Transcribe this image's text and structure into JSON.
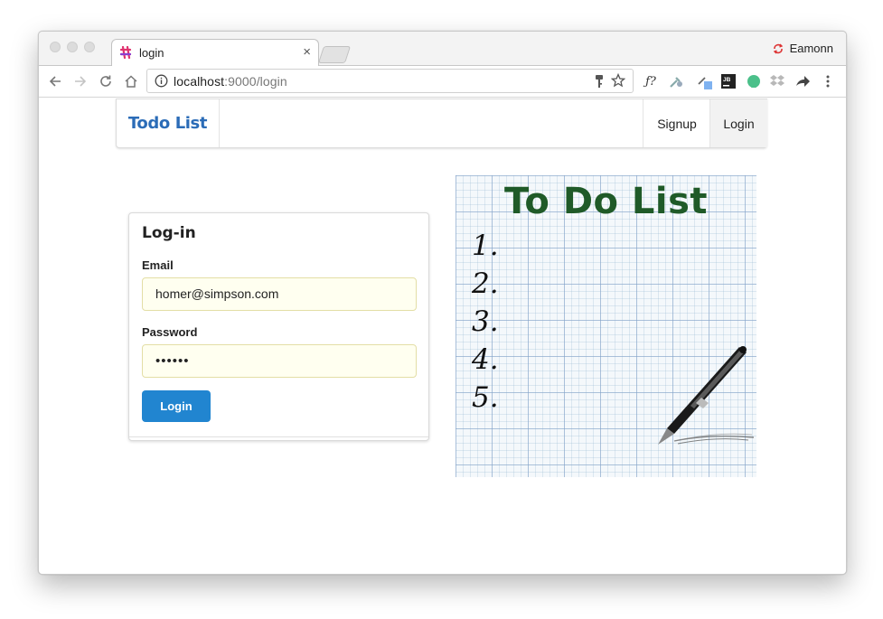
{
  "browser": {
    "tab_title": "login",
    "tab_close": "×",
    "profile_name": "Eamonn",
    "url_host": "localhost",
    "url_rest": ":9000/login"
  },
  "navbar": {
    "brand": "Todo List",
    "items": [
      {
        "label": "Signup",
        "active": false
      },
      {
        "label": "Login",
        "active": true
      }
    ]
  },
  "login_form": {
    "title": "Log-in",
    "email_label": "Email",
    "email_value": "homer@simpson.com",
    "password_label": "Password",
    "password_value": "••••••",
    "submit_label": "Login"
  },
  "illustration": {
    "heading": "To Do List",
    "numbers": [
      "1.",
      "2.",
      "3.",
      "4.",
      "5."
    ]
  },
  "colors": {
    "brand": "#2b6cb7",
    "button": "#2185d0",
    "autofill_bg": "#fffff0",
    "heading_green": "#1f5a28"
  }
}
